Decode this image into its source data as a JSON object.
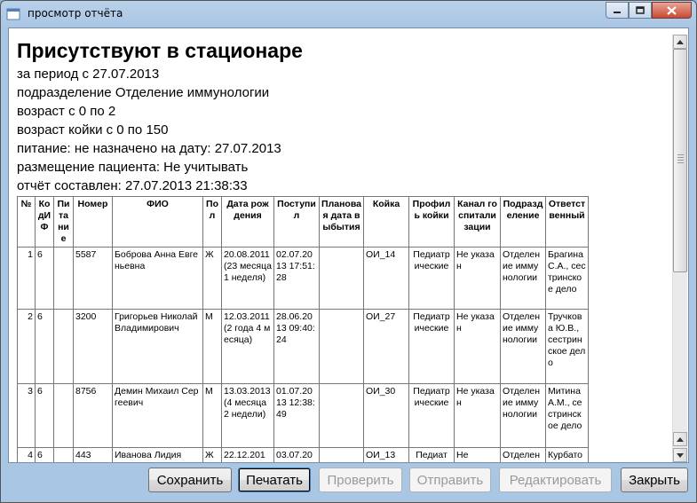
{
  "window": {
    "title": "просмотр отчёта",
    "controls": {
      "minimize": "minimize-icon",
      "maximize": "maximize-icon",
      "close": "close-icon"
    }
  },
  "report": {
    "title": "Присутствуют в стационаре",
    "lines": [
      "за период с 27.07.2013",
      "подразделение Отделение иммунологии",
      "возраст с 0 по 2",
      "возраст койки с 0 по 150",
      "питание: не назначено на дату: 27.07.2013",
      "размещение пациента: Не учитывать",
      "отчёт составлен: 27.07.2013 21:38:33"
    ],
    "columns": [
      "№",
      "КодИФ",
      "Питание",
      "Номер",
      "ФИО",
      "Пол",
      "Дата рождения",
      "Поступил",
      "Плановая дата выбытия",
      "Койка",
      "Профиль койки",
      "Канал госпитализации",
      "Подразделение",
      "Ответственный"
    ],
    "rows": [
      [
        "1",
        "6",
        "",
        "5587",
        "Боброва Анна Евгеньевна",
        "Ж",
        "20.08.2011(23 месяца 1 неделя)",
        "02.07.2013 17:51:28",
        "",
        "ОИ_14",
        "Педиатрические",
        "Не указан",
        "Отделение иммунологии",
        "Брагина С.А., сестринское дело"
      ],
      [
        "2",
        "6",
        "",
        "3200",
        "Григорьев Николай Владимирович",
        "М",
        "12.03.2011(2 года 4 месяца)",
        "28.06.2013 09:40:24",
        "",
        "ОИ_27",
        "Педиатрические",
        "Не указан",
        "Отделение иммунологии",
        "Тручкова Ю.В., сестринское дело"
      ],
      [
        "3",
        "6",
        "",
        "8756",
        "Демин Михаил Сергеевич",
        "М",
        "13.03.2013(4 месяца 2 недели)",
        "01.07.2013 12:38:49",
        "",
        "ОИ_30",
        "Педиатрические",
        "Не указан",
        "Отделение иммунологии",
        "Митина А.М., сестринское дело"
      ],
      [
        "4",
        "6",
        "",
        "443",
        "Иванова Лидия",
        "Ж",
        "22.12.201",
        "03.07.20",
        "",
        "ОИ_13",
        "Педиат",
        "Не",
        "Отделен",
        "Курбато"
      ]
    ]
  },
  "scrollbar": {
    "up": "scroll-up-icon",
    "down": "scroll-down-icon"
  },
  "buttons": {
    "save": "Сохранить",
    "print": "Печатать",
    "check": "Проверить",
    "send": "Отправить",
    "edit": "Редактировать",
    "close": "Закрыть"
  }
}
